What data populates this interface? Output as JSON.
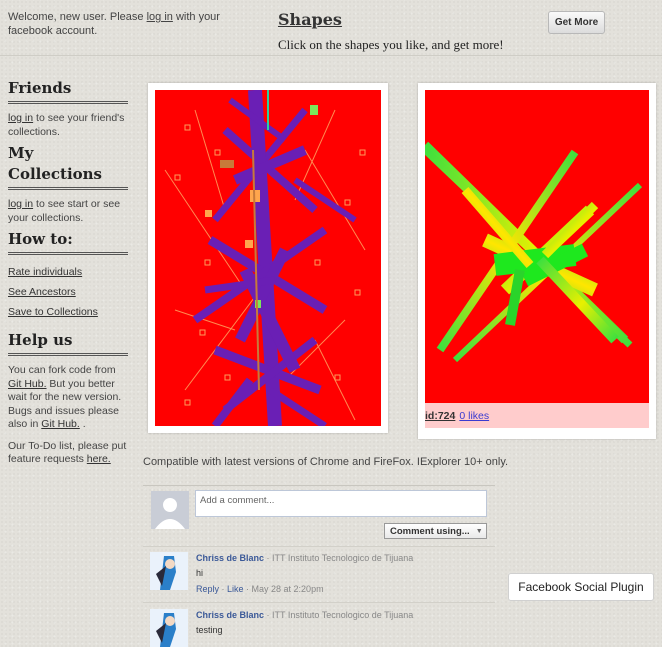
{
  "header": {
    "welcome_prefix": "Welcome, new user. Please ",
    "welcome_link": "log in",
    "welcome_suffix": " with your facebook account.",
    "title": "Shapes",
    "subtitle": "Click on the shapes you like, and get more!",
    "get_more_label": "Get More"
  },
  "sidebar": {
    "friends_heading": "Friends",
    "friends_link": "log in",
    "friends_text": " to see your friend's collections.",
    "collections_heading": "My Collections",
    "collections_link": "log in",
    "collections_text": " to see start or see your collections.",
    "howto_heading": "How to:",
    "howto_links": [
      "Rate individuals",
      "See Ancestors",
      "Save to Collections"
    ],
    "help_heading": "Help us",
    "help_text_1": "You can fork code from ",
    "help_link_1": "Git Hub.",
    "help_text_2": " But you better wait for the new version. Bugs and issues please also in ",
    "help_link_2": "Git Hub.",
    "help_text_3": " .",
    "todo_text": "Our To-Do list, please put feature requests ",
    "todo_link": "here."
  },
  "shapes": [
    {
      "id_label": "",
      "likes_label": ""
    },
    {
      "id_label": "id:724",
      "likes_label": "0 likes"
    }
  ],
  "compat_text": "Compatible with latest versions of Chrome and FireFox. IExplorer 10+ only.",
  "comments": {
    "placeholder": "Add a comment...",
    "comment_using_label": "Comment using...",
    "items": [
      {
        "name": "Chriss de Blanc",
        "affiliation": " · ITT Instituto Tecnologico de Tijuana",
        "text": "hi",
        "reply": "Reply",
        "like": "Like",
        "time": " · May 28 at 2:20pm"
      },
      {
        "name": "Chriss de Blanc",
        "affiliation": " · ITT Instituto Tecnologico de Tijuana",
        "text": "testing"
      }
    ]
  },
  "plugin_label": "Facebook Social Plugin",
  "colors": {
    "canvas_bg": "#ff0000",
    "meta_bg": "#ffcccc",
    "purple": "#6a1fb5",
    "fb_blue": "#3b5998"
  },
  "icons": {
    "avatar_placeholder": "user-silhouette-icon",
    "caret": "caret-down-icon"
  }
}
